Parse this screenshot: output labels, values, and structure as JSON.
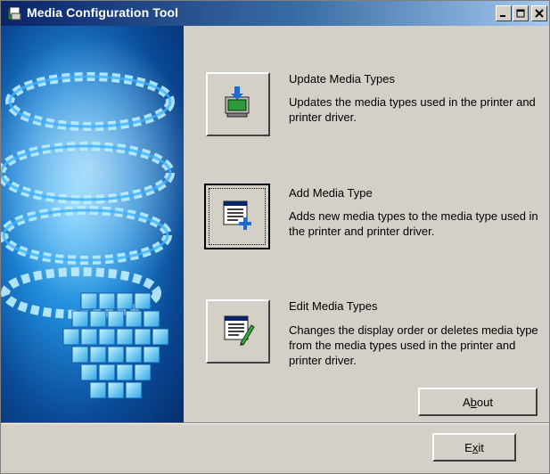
{
  "window": {
    "title": "Media Configuration Tool"
  },
  "actions": [
    {
      "title": "Update Media Types",
      "description": "Updates the media types used in the printer and printer driver.",
      "icon": "update-media-icon"
    },
    {
      "title": "Add Media Type",
      "description": "Adds new media types to the media type used in the printer and printer driver.",
      "icon": "add-media-icon"
    },
    {
      "title": "Edit Media Types",
      "description": "Changes the display order or deletes media type from the media types used in the printer and printer driver.",
      "icon": "edit-media-icon"
    }
  ],
  "buttons": {
    "about": {
      "label_before": "A",
      "mnemonic": "b",
      "label_after": "out"
    },
    "exit": {
      "label_before": "E",
      "mnemonic": "x",
      "label_after": "it"
    }
  },
  "colors": {
    "titlebar_start": "#0a246a",
    "titlebar_end": "#a6caf0",
    "face": "#d4d0c8"
  }
}
